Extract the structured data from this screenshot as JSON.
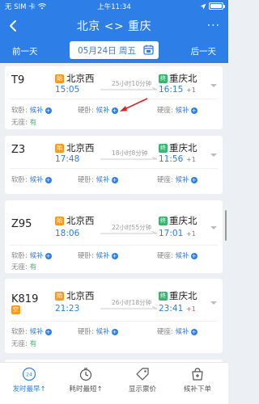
{
  "status_bar": {
    "carrier": "无 SIM 卡",
    "time": "上午11:34"
  },
  "header": {
    "title": "北京 <> 重庆",
    "more": "···"
  },
  "date_bar": {
    "prev": "前一天",
    "date": "05月24日 周五",
    "next": "后一天"
  },
  "trains": [
    {
      "no": "T9",
      "from": "北京西",
      "from_badge": "始",
      "dep": "15:05",
      "duration": "25小时10分钟",
      "to": "重庆北",
      "to_badge": "终",
      "arr": "16:15",
      "plus": "+1",
      "seats": [
        {
          "label": "软卧:",
          "status": "候补"
        },
        {
          "label": "硬卧:",
          "status": "候补"
        },
        {
          "label": "硬座:",
          "status": "候补"
        }
      ],
      "noseat_label": "无座:",
      "noseat_status": "有"
    },
    {
      "no": "Z3",
      "from": "北京西",
      "from_badge": "始",
      "dep": "17:48",
      "duration": "18小时8分钟",
      "to": "重庆北",
      "to_badge": "终",
      "arr": "11:56",
      "plus": "+1",
      "seats": [
        {
          "label": "软卧:",
          "status": "候补"
        },
        {
          "label": "硬卧:",
          "status": "候补"
        },
        {
          "label": "硬座:",
          "status": "候补"
        }
      ]
    },
    {
      "no": "Z95",
      "from": "北京西",
      "from_badge": "始",
      "dep": "18:06",
      "duration": "22小时55分钟",
      "to": "重庆北",
      "to_badge": "终",
      "arr": "17:01",
      "plus": "+1",
      "seats": [
        {
          "label": "软卧:",
          "status": "候补"
        },
        {
          "label": "硬卧:",
          "status": "候补"
        },
        {
          "label": "硬座:",
          "status": "候补"
        }
      ],
      "noseat_label": "无座:",
      "noseat_status": "有"
    },
    {
      "no": "K819",
      "no_badge": "空",
      "from": "北京西",
      "from_badge": "始",
      "dep": "21:23",
      "duration": "26小时18分钟",
      "to": "重庆北",
      "to_badge": "终",
      "arr": "23:41",
      "plus": "+1",
      "seats": [
        {
          "label": "软卧:",
          "status": "候补"
        },
        {
          "label": "硬卧:",
          "status": "候补"
        },
        {
          "label": "硬座:",
          "status": "候补"
        }
      ],
      "noseat_label": "无座:",
      "noseat_status": "有"
    }
  ],
  "tabs": [
    {
      "label": "发时最早↑",
      "icon": "departure-clock-icon",
      "badge": "24"
    },
    {
      "label": "耗时最短↑",
      "icon": "timer-icon"
    },
    {
      "label": "显示票价",
      "icon": "price-tag-icon"
    },
    {
      "label": "候补下单",
      "icon": "waitlist-bag-icon"
    }
  ],
  "colors": {
    "primary": "#2d7ee6",
    "orange_badge": "#f59b23",
    "green_badge": "#3cb371",
    "red_plus": "#e25b4b"
  }
}
